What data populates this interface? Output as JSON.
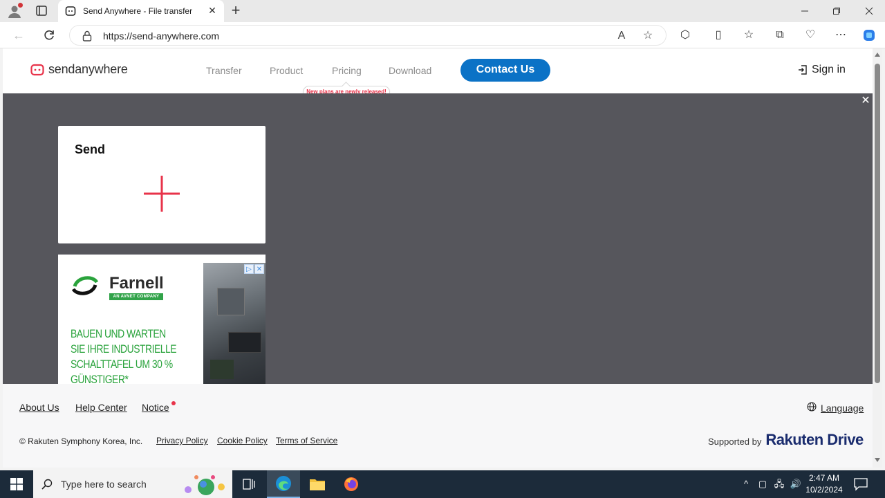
{
  "browser": {
    "tab_title": "Send Anywhere - File transfer",
    "url": "https://send-anywhere.com"
  },
  "site": {
    "logo_text": "sendanywhere",
    "nav": [
      "Transfer",
      "Product",
      "Pricing",
      "Download"
    ],
    "pricing_badge": "New plans are newly released!",
    "contact_button": "Contact Us",
    "sign_in": "Sign in",
    "accent_color": "#e8334a",
    "primary_color": "#0b72c6"
  },
  "send_card": {
    "title": "Send"
  },
  "ad": {
    "brand": "Farnell",
    "tagline": "AN AVNET COMPANY",
    "headline_lines": [
      "BAUEN UND WARTEN",
      "SIE IHRE INDUSTRIELLE",
      "SCHALTTAFEL UM 30 %",
      "GÜNSTIGER*"
    ]
  },
  "footer": {
    "links": [
      "About Us",
      "Help Center",
      "Notice"
    ],
    "language": "Language",
    "copyright": "© Rakuten Symphony Korea, Inc.",
    "legal_links": [
      "Privacy Policy",
      "Cookie Policy",
      "Terms of Service"
    ],
    "supported_by": "Supported by",
    "supporter_brand": "Rakuten Drive"
  },
  "taskbar": {
    "search_placeholder": "Type here to search",
    "time": "2:47 AM",
    "date": "10/2/2024"
  }
}
